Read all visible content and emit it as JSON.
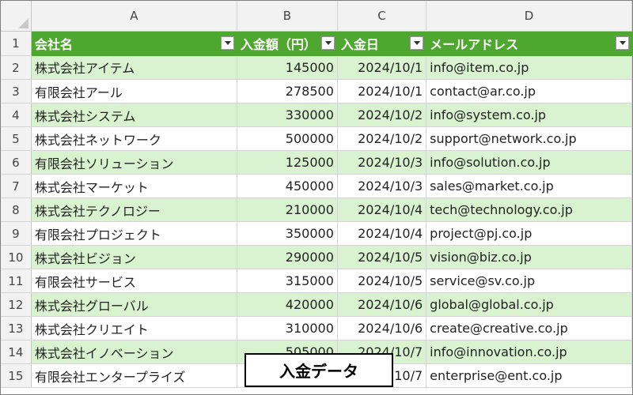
{
  "columns": [
    "A",
    "B",
    "C",
    "D"
  ],
  "header": {
    "row_number": "1",
    "company": "会社名",
    "amount": "入金額（円）",
    "date": "入金日",
    "email": "メールアドレス"
  },
  "rows": [
    {
      "n": "2",
      "company": "株式会社アイテム",
      "amount": "145000",
      "date": "2024/10/1",
      "email": "info@item.co.jp"
    },
    {
      "n": "3",
      "company": "有限会社アール",
      "amount": "278500",
      "date": "2024/10/1",
      "email": "contact@ar.co.jp"
    },
    {
      "n": "4",
      "company": "株式会社システム",
      "amount": "330000",
      "date": "2024/10/2",
      "email": "info@system.co.jp"
    },
    {
      "n": "5",
      "company": "株式会社ネットワーク",
      "amount": "500000",
      "date": "2024/10/2",
      "email": "support@network.co.jp"
    },
    {
      "n": "6",
      "company": "有限会社ソリューション",
      "amount": "125000",
      "date": "2024/10/3",
      "email": "info@solution.co.jp"
    },
    {
      "n": "7",
      "company": "株式会社マーケット",
      "amount": "450000",
      "date": "2024/10/3",
      "email": "sales@market.co.jp"
    },
    {
      "n": "8",
      "company": "株式会社テクノロジー",
      "amount": "210000",
      "date": "2024/10/4",
      "email": "tech@technology.co.jp"
    },
    {
      "n": "9",
      "company": "有限会社プロジェクト",
      "amount": "350000",
      "date": "2024/10/4",
      "email": "project@pj.co.jp"
    },
    {
      "n": "10",
      "company": "株式会社ビジョン",
      "amount": "290000",
      "date": "2024/10/5",
      "email": "vision@biz.co.jp"
    },
    {
      "n": "11",
      "company": "有限会社サービス",
      "amount": "315000",
      "date": "2024/10/5",
      "email": "service@sv.co.jp"
    },
    {
      "n": "12",
      "company": "株式会社グローバル",
      "amount": "420000",
      "date": "2024/10/6",
      "email": "global@global.co.jp"
    },
    {
      "n": "13",
      "company": "株式会社クリエイト",
      "amount": "310000",
      "date": "2024/10/6",
      "email": "create@creative.co.jp"
    },
    {
      "n": "14",
      "company": "株式会社イノベーション",
      "amount": "505000",
      "date": "2024/10/7",
      "email": "info@innovation.co.jp"
    },
    {
      "n": "15",
      "company": "有限会社エンタープライズ",
      "amount": "",
      "date": "10/7",
      "email": "enterprise@ent.co.jp"
    }
  ],
  "sheet_label": "入金データ",
  "colors": {
    "header_green": "#4ea72e",
    "band_green": "#d9f2d0"
  }
}
